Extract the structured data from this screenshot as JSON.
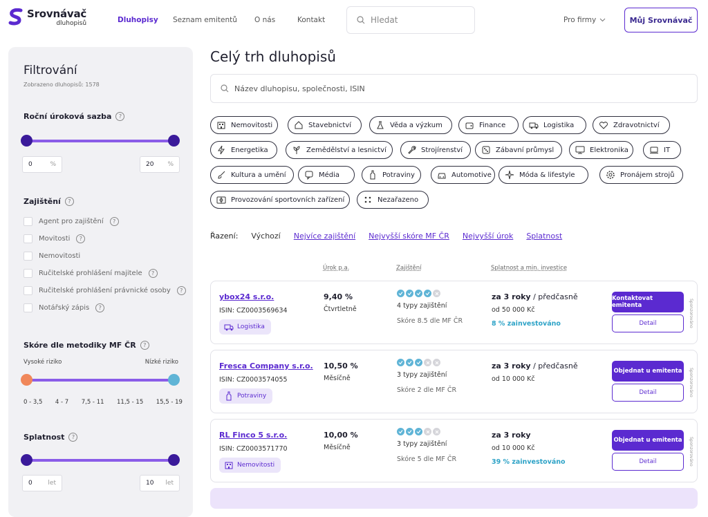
{
  "header": {
    "logo_title": "Srovnávač",
    "logo_sub": "dluhopisů",
    "nav": [
      "Dluhopisy",
      "Seznam emitentů",
      "O nás",
      "Kontakt"
    ],
    "search_placeholder": "Hledat",
    "pro_firmy": "Pro firmy",
    "my_button": "Můj Srovnávač"
  },
  "sidebar": {
    "title": "Filtrování",
    "count": "Zobrazeno dluhopisů: 1578",
    "rate_title": "Roční úroková sazba",
    "rate_min": "0",
    "rate_max": "20",
    "rate_unit": "%",
    "guarantee_title": "Zajištění",
    "guarantees": [
      "Agent pro zajištění",
      "Movitosti",
      "Nemovitosti",
      "Ručitelské prohlášení majitele",
      "Ručitelské prohlášení právnické osoby",
      "Notářský zápis"
    ],
    "guarantees_help": [
      true,
      true,
      false,
      true,
      true,
      true
    ],
    "score_title": "Skóre dle metodiky MF ČR",
    "risk_high": "Vysoké riziko",
    "risk_low": "Nízké riziko",
    "score_ticks": [
      "0 - 3,5",
      "4 - 7",
      "7,5 - 11",
      "11,5 - 15",
      "15,5 - 19"
    ],
    "maturity_title": "Splatnost",
    "mat_min": "0",
    "mat_max": "10",
    "mat_unit": "let"
  },
  "main": {
    "title": "Celý trh dluhopisů",
    "search_placeholder": "Název dluhopisu, společnosti, ISIN",
    "chips": [
      {
        "label": "Nemovitosti",
        "icon": "building-icon"
      },
      {
        "label": "Stavebnictví",
        "icon": "house-icon"
      },
      {
        "label": "Věda a výzkum",
        "icon": "flask-icon"
      },
      {
        "label": "Finance",
        "icon": "wallet-icon"
      },
      {
        "label": "Logistika",
        "icon": "truck-icon"
      },
      {
        "label": "Zdravotnictví",
        "icon": "heart-icon"
      },
      {
        "label": "Energetika",
        "icon": "lightning-icon"
      },
      {
        "label": "Zemědělství a lesnictví",
        "icon": "plant-icon"
      },
      {
        "label": "Strojírenství",
        "icon": "wrench-icon"
      },
      {
        "label": "Zábavní průmysl",
        "icon": "dice-icon"
      },
      {
        "label": "Elektronika",
        "icon": "monitor-icon"
      },
      {
        "label": "IT",
        "icon": "laptop-icon"
      },
      {
        "label": "Kultura a umění",
        "icon": "brush-icon"
      },
      {
        "label": "Média",
        "icon": "chat-icon"
      },
      {
        "label": "Potraviny",
        "icon": "bottle-icon"
      },
      {
        "label": "Automotive",
        "icon": "car-icon"
      },
      {
        "label": "Móda & lifestyle",
        "icon": "sparkle-icon"
      },
      {
        "label": "Pronájem strojů",
        "icon": "gear-icon"
      },
      {
        "label": "Provozování sportovních zařízení",
        "icon": "stadium-icon"
      },
      {
        "label": "Nezařazeno",
        "icon": "dots-icon"
      }
    ],
    "sort_label": "Řazení:",
    "sort_default": "Výchozí",
    "sort_links": [
      "Nejvíce zajištění",
      "Nejvyšší skóre MF ČR",
      "Nejvyšší úrok",
      "Splatnost"
    ],
    "columns": [
      "Úrok p.a.",
      "Zajištění",
      "Splatnost a min. investice"
    ],
    "bonds": [
      {
        "name": "ybox24 s.r.o.",
        "isin": "ISIN: CZ0003569634",
        "sector": "Logistika",
        "sector_icon": "truck-icon",
        "rate": "9,40 %",
        "freq": "Čtvrtletně",
        "dots": 4,
        "types": "4 typy zajištění",
        "score": "Skóre 8.5 dle MF ČR",
        "maturity": "za 3 roky",
        "early": " / předčasně",
        "min": "od 50 000 Kč",
        "invested": "8 % zainvestováno",
        "cta": "Kontaktovat emitenta",
        "detail": "Detail",
        "sponsored": "Sponzorováno"
      },
      {
        "name": "Fresca Company s.r.o.",
        "isin": "ISIN: CZ0003574055",
        "sector": "Potraviny",
        "sector_icon": "bottle-icon",
        "rate": "10,50 %",
        "freq": "Měsíčně",
        "dots": 3,
        "types": "3 typy zajištění",
        "score": "Skóre 2 dle MF ČR",
        "maturity": "za 3 roky",
        "early": " / předčasně",
        "min": "od 10 000 Kč",
        "invested": "",
        "cta": "Objednat u emitenta",
        "detail": "Detail",
        "sponsored": "Sponzorováno"
      },
      {
        "name": "RL Finco 5 s.r.o.",
        "isin": "ISIN: CZ0003571770",
        "sector": "Nemovitosti",
        "sector_icon": "building-icon",
        "rate": "10,00 %",
        "freq": "Měsíčně",
        "dots": 3,
        "types": "3 typy zajištění",
        "score": "Skóre 5 dle MF ČR",
        "maturity": "za 3 roky",
        "early": "",
        "min": "od 10 000 Kč",
        "invested": "39 % zainvestováno",
        "cta": "Objednat u emitenta",
        "detail": "Detail",
        "sponsored": "Sponzorováno"
      }
    ]
  },
  "colors": {
    "accent": "#5b2ad0",
    "slider": "#8a5ce8",
    "knob": "#3a1a9a",
    "risk_high": "#f0875a",
    "risk_low": "#5fb4d6",
    "dot_on": "#5fb4d6"
  }
}
